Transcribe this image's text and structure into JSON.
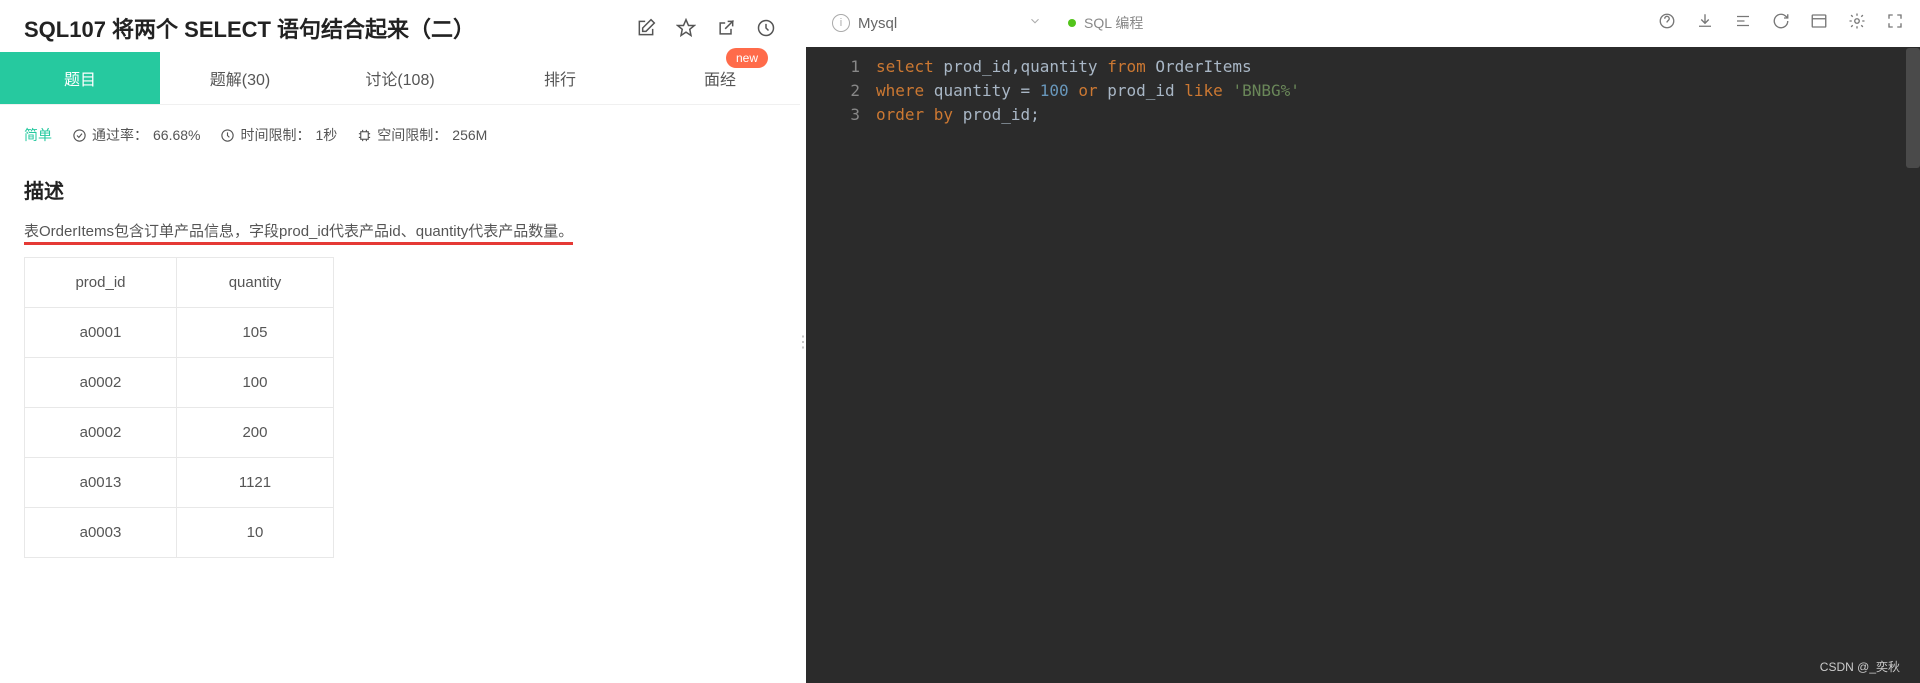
{
  "problem": {
    "title": "SQL107  将两个 SELECT 语句结合起来（二）",
    "tabs": {
      "problem": "题目",
      "solution": "题解(30)",
      "discuss": "讨论(108)",
      "rank": "排行",
      "interview": "面经"
    },
    "badge_new": "new",
    "meta": {
      "difficulty": "简单",
      "pass_rate_label": "通过率：",
      "pass_rate": "66.68%",
      "time_label": "时间限制：",
      "time": "1秒",
      "space_label": "空间限制：",
      "space": "256M"
    },
    "section_desc": "描述",
    "description": "表OrderItems包含订单产品信息，字段prod_id代表产品id、quantity代表产品数量。",
    "table": {
      "headers": [
        "prod_id",
        "quantity"
      ],
      "rows": [
        [
          "a0001",
          "105"
        ],
        [
          "a0002",
          "100"
        ],
        [
          "a0002",
          "200"
        ],
        [
          "a0013",
          "1121"
        ],
        [
          "a0003",
          "10"
        ]
      ]
    }
  },
  "editor": {
    "language": "Mysql",
    "project_label": "SQL 编程",
    "code_lines": [
      {
        "n": 1,
        "tokens": [
          {
            "t": "select",
            "c": "kw"
          },
          {
            "t": " prod_id,quantity ",
            "c": "id"
          },
          {
            "t": "from",
            "c": "kw"
          },
          {
            "t": " OrderItems",
            "c": "id"
          }
        ]
      },
      {
        "n": 2,
        "tokens": [
          {
            "t": "where",
            "c": "kw"
          },
          {
            "t": " quantity = ",
            "c": "id"
          },
          {
            "t": "100",
            "c": "num"
          },
          {
            "t": " ",
            "c": "id"
          },
          {
            "t": "or",
            "c": "kw"
          },
          {
            "t": " prod_id ",
            "c": "id"
          },
          {
            "t": "like",
            "c": "kw"
          },
          {
            "t": " ",
            "c": "id"
          },
          {
            "t": "'BNBG%'",
            "c": "str"
          }
        ]
      },
      {
        "n": 3,
        "tokens": [
          {
            "t": "order by",
            "c": "kw"
          },
          {
            "t": " prod_id;",
            "c": "id"
          }
        ]
      }
    ]
  },
  "watermark": "CSDN @_奕秋"
}
